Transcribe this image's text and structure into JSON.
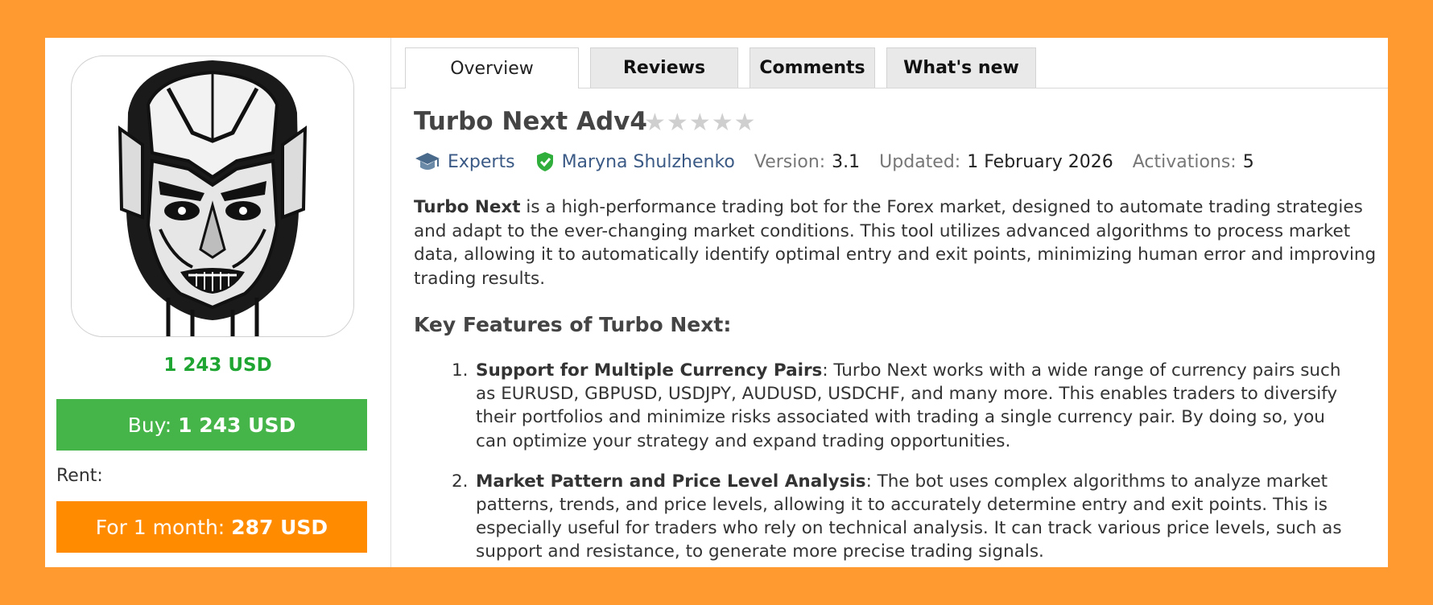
{
  "product": {
    "image_icon": "robot-skull-icon",
    "price": "1 243 USD",
    "buy_label": "Buy:",
    "buy_price": "1 243 USD",
    "rent_label": "Rent:",
    "rent_period": "For 1 month:",
    "rent_price": "287 USD"
  },
  "tabs": [
    {
      "label": "Overview",
      "active": true
    },
    {
      "label": "Reviews"
    },
    {
      "label": "Comments"
    },
    {
      "label": "What's new"
    }
  ],
  "header": {
    "title": "Turbo Next Adv4",
    "rating_stars": 0,
    "rating_max": 5
  },
  "meta": {
    "category": "Experts",
    "author": "Maryna Shulzhenko",
    "version_label": "Version:",
    "version": "3.1",
    "updated_label": "Updated:",
    "updated": "1 February 2026",
    "activations_label": "Activations:",
    "activations": "5"
  },
  "description": {
    "lead": "Turbo Next",
    "text": " is a high-performance trading bot for the Forex market, designed to automate trading strategies and adapt to the ever-changing market conditions. This tool utilizes advanced algorithms to process market data, allowing it to automatically identify optimal entry and exit points, minimizing human error and improving trading results."
  },
  "features_heading": "Key Features of Turbo Next:",
  "features": [
    {
      "num": "1.",
      "title": "Support for Multiple Currency Pairs",
      "text": ": Turbo Next works with a wide range of currency pairs such as EURUSD, GBPUSD, USDJPY, AUDUSD, USDCHF, and many more. This enables traders to diversify their portfolios and minimize risks associated with trading a single currency pair. By doing so, you can optimize your strategy and expand trading opportunities."
    },
    {
      "num": "2.",
      "title": "Market Pattern and Price Level Analysis",
      "text": ": The bot uses complex algorithms to analyze market patterns, trends, and price levels, allowing it to accurately determine entry and exit points. This is especially useful for traders who rely on technical analysis. It can track various price levels, such as support and resistance, to generate more precise trading signals."
    }
  ],
  "colors": {
    "background": "#ff9a30",
    "buy": "#45b549",
    "rent": "#ff8c00",
    "price": "#1fa531",
    "link": "#3b5a85"
  }
}
